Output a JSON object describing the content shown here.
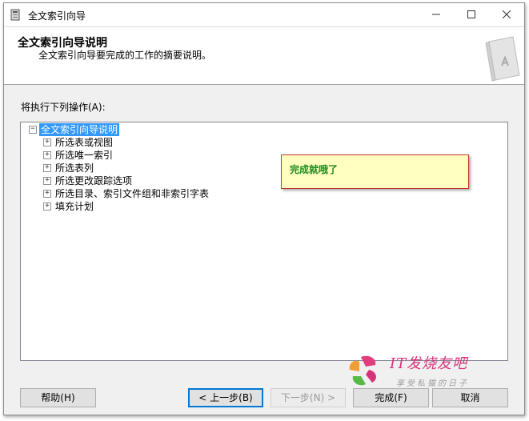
{
  "window": {
    "title": "全文索引向导",
    "icon": "wizard-app-icon"
  },
  "header": {
    "title": "全文索引向导说明",
    "subtitle": "全文索引向导要完成的工作的摘要说明。"
  },
  "action_label": "将执行下列操作(A):",
  "tree": {
    "root": "全文索引向导说明",
    "items": [
      "所选表或视图",
      "所选唯一索引",
      "所选表列",
      "所选更改跟踪选项",
      "所选目录、索引文件组和非索引字表",
      "填充计划"
    ]
  },
  "callout": "完成就哦了",
  "watermark": {
    "title": "IT发烧友吧",
    "subtitle": "享受私猫的日子"
  },
  "buttons": {
    "help": "帮助(H)",
    "back": "< 上一步(B)",
    "next": "下一步(N) >",
    "finish": "完成(F)",
    "cancel": "取消"
  },
  "colors": {
    "selection": "#3399ff",
    "callout_bg": "#ffffc0",
    "callout_border": "#c0392b",
    "callout_text": "#1e8a1e",
    "focus_border": "#0078d7"
  }
}
